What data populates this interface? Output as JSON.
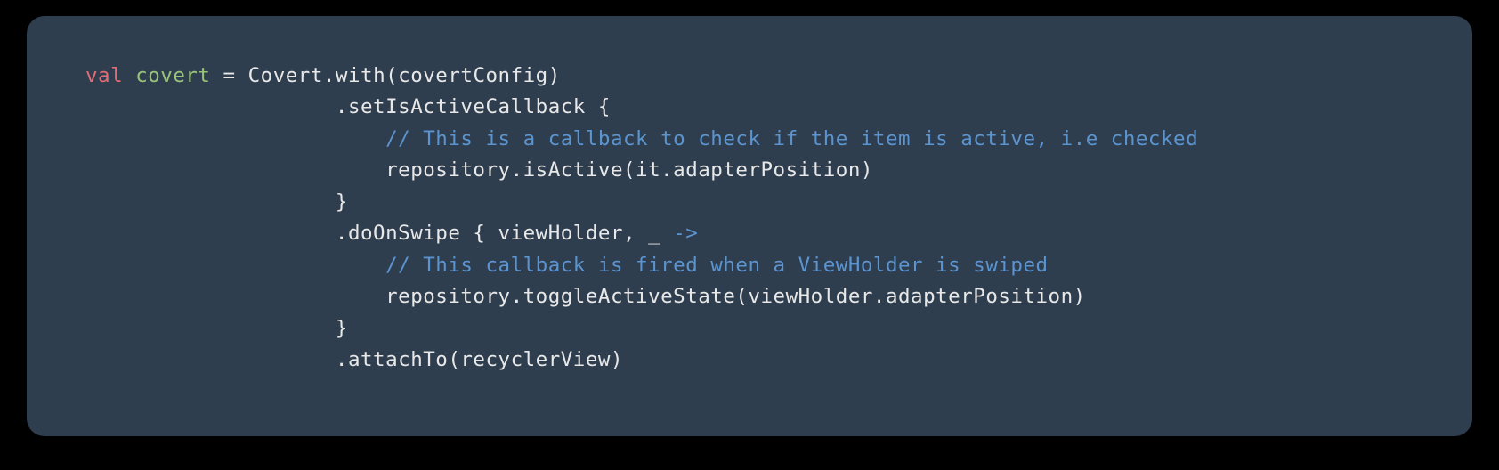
{
  "code": {
    "lines": [
      {
        "tokens": [
          {
            "cls": "tok-keyword",
            "text": "val"
          },
          {
            "cls": "tok-normal",
            "text": " "
          },
          {
            "cls": "tok-varname",
            "text": "covert"
          },
          {
            "cls": "tok-normal",
            "text": " "
          },
          {
            "cls": "tok-operator",
            "text": "="
          },
          {
            "cls": "tok-normal",
            "text": " Covert.with(covertConfig)"
          }
        ]
      },
      {
        "tokens": [
          {
            "cls": "tok-normal",
            "text": "                    .setIsActiveCallback {"
          }
        ]
      },
      {
        "tokens": [
          {
            "cls": "tok-normal",
            "text": "                        "
          },
          {
            "cls": "tok-comment",
            "text": "// This is a callback to check if the item is active, i.e checked"
          }
        ]
      },
      {
        "tokens": [
          {
            "cls": "tok-normal",
            "text": "                        repository.isActive(it.adapterPosition)"
          }
        ]
      },
      {
        "tokens": [
          {
            "cls": "tok-normal",
            "text": "                    }"
          }
        ]
      },
      {
        "tokens": [
          {
            "cls": "tok-normal",
            "text": "                    .doOnSwipe { viewHolder, _ "
          },
          {
            "cls": "tok-arrow",
            "text": "->"
          }
        ]
      },
      {
        "tokens": [
          {
            "cls": "tok-normal",
            "text": "                        "
          },
          {
            "cls": "tok-comment",
            "text": "// This callback is fired when a ViewHolder is swiped"
          }
        ]
      },
      {
        "tokens": [
          {
            "cls": "tok-normal",
            "text": "                        repository.toggleActiveState(viewHolder.adapterPosition)"
          }
        ]
      },
      {
        "tokens": [
          {
            "cls": "tok-normal",
            "text": "                    }"
          }
        ]
      },
      {
        "tokens": [
          {
            "cls": "tok-normal",
            "text": "                    .attachTo(recyclerView)"
          }
        ]
      }
    ]
  }
}
